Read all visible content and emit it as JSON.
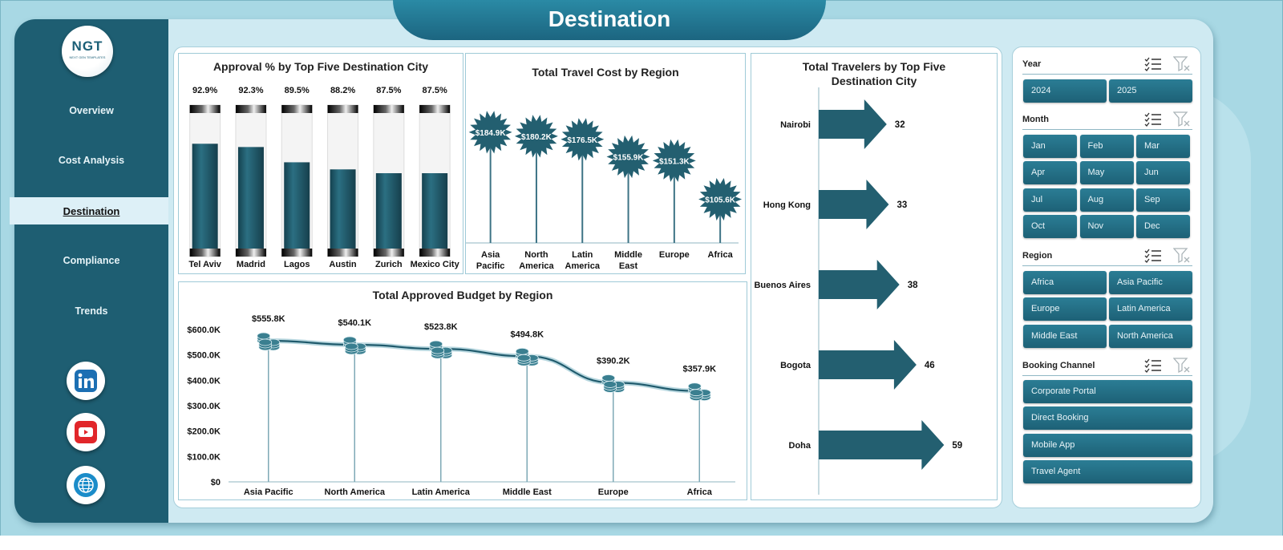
{
  "page": {
    "title": "Destination",
    "logo_text": "NGT",
    "logo_subtitle": "NEXT GEN TEMPLATES"
  },
  "sidebar": {
    "items": [
      {
        "label": "Overview",
        "active": false
      },
      {
        "label": "Cost Analysis",
        "active": false
      },
      {
        "label": "Destination",
        "active": true
      },
      {
        "label": "Compliance",
        "active": false
      },
      {
        "label": "Trends",
        "active": false
      }
    ],
    "social": [
      {
        "name": "linkedin-icon",
        "color": "#1c6fb3"
      },
      {
        "name": "youtube-icon",
        "color": "#e1262a"
      },
      {
        "name": "globe-icon",
        "color": "#1b8cc9"
      }
    ]
  },
  "colors": {
    "teal_dark": "#1e5e72",
    "teal_bar": "#235f70",
    "accent": "#2a8aa5"
  },
  "chart_data": [
    {
      "id": "approval",
      "type": "bar",
      "title": "Approval % by Top Five Destination City",
      "categories": [
        "Tel Aviv",
        "Madrid",
        "Lagos",
        "Austin",
        "Zurich",
        "Mexico City"
      ],
      "values": [
        92.9,
        92.3,
        89.5,
        88.2,
        87.5,
        87.5
      ],
      "value_labels": [
        "92.9%",
        "92.3%",
        "89.5%",
        "88.2%",
        "87.5%",
        "87.5%"
      ],
      "ylim": [
        0,
        100
      ]
    },
    {
      "id": "travel-cost",
      "type": "bar",
      "title": "Total Travel Cost by Region",
      "categories": [
        "Asia Pacific",
        "North America",
        "Latin America",
        "Middle East",
        "Europe",
        "Africa"
      ],
      "category_lines": [
        [
          "Asia",
          "Pacific"
        ],
        [
          "North",
          "America"
        ],
        [
          "Latin",
          "America"
        ],
        [
          "Middle",
          "East"
        ],
        [
          "Europe"
        ],
        [
          "Africa"
        ]
      ],
      "values": [
        184.9,
        180.2,
        176.5,
        155.9,
        151.3,
        105.6
      ],
      "value_labels": [
        "$184.9K",
        "$180.2K",
        "$176.5K",
        "$155.9K",
        "$151.3K",
        "$105.6K"
      ],
      "unit": "K USD"
    },
    {
      "id": "travelers",
      "type": "bar",
      "title_lines": [
        "Total Travelers by Top Five",
        "Destination City"
      ],
      "categories": [
        "Nairobi",
        "Hong Kong",
        "Buenos Aires",
        "Bogota",
        "Doha"
      ],
      "values": [
        32,
        33,
        38,
        46,
        59
      ],
      "value_labels": [
        "32",
        "33",
        "38",
        "46",
        "59"
      ],
      "orientation": "horizontal"
    },
    {
      "id": "approved-budget",
      "type": "line",
      "title": "Total Approved Budget by Region",
      "categories": [
        "Asia Pacific",
        "North America",
        "Latin America",
        "Middle East",
        "Europe",
        "Africa"
      ],
      "values": [
        555.8,
        540.1,
        523.8,
        494.8,
        390.2,
        357.9
      ],
      "value_labels": [
        "$555.8K",
        "$540.1K",
        "$523.8K",
        "$494.8K",
        "$390.2K",
        "$357.9K"
      ],
      "yticks": [
        "$0",
        "$100.0K",
        "$200.0K",
        "$300.0K",
        "$400.0K",
        "$500.0K",
        "$600.0K"
      ],
      "ylim": [
        0,
        600
      ]
    }
  ],
  "slicers": {
    "year": {
      "title": "Year",
      "options": [
        "2024",
        "2025"
      ]
    },
    "month": {
      "title": "Month",
      "options": [
        "Jan",
        "Feb",
        "Mar",
        "Apr",
        "May",
        "Jun",
        "Jul",
        "Aug",
        "Sep",
        "Oct",
        "Nov",
        "Dec"
      ]
    },
    "region": {
      "title": "Region",
      "options": [
        "Africa",
        "Asia Pacific",
        "Europe",
        "Latin America",
        "Middle East",
        "North America"
      ]
    },
    "channel": {
      "title": "Booking Channel",
      "options": [
        "Corporate Portal",
        "Direct Booking",
        "Mobile App",
        "Travel Agent"
      ]
    }
  }
}
